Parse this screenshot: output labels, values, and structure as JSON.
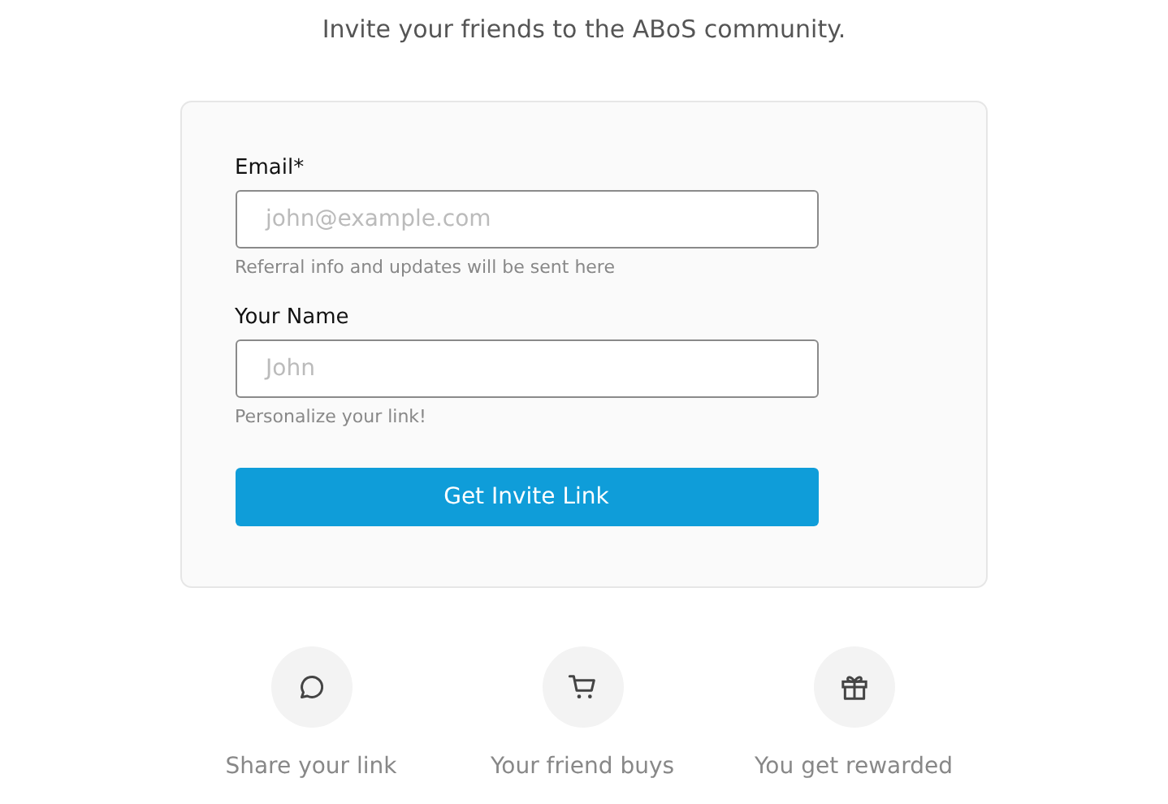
{
  "heading": "Invite your friends to the ABoS community.",
  "form": {
    "fields": [
      {
        "label": "Email*",
        "placeholder": "john@example.com",
        "hint": "Referral info and updates will be sent here"
      },
      {
        "label": "Your Name",
        "placeholder": "John",
        "hint": "Personalize your link!"
      }
    ],
    "button": "Get Invite Link"
  },
  "steps": [
    {
      "kind": "chat",
      "label": "Share your link"
    },
    {
      "kind": "cart",
      "label": "Your friend buys"
    },
    {
      "kind": "gift",
      "label": "You get rewarded"
    }
  ]
}
